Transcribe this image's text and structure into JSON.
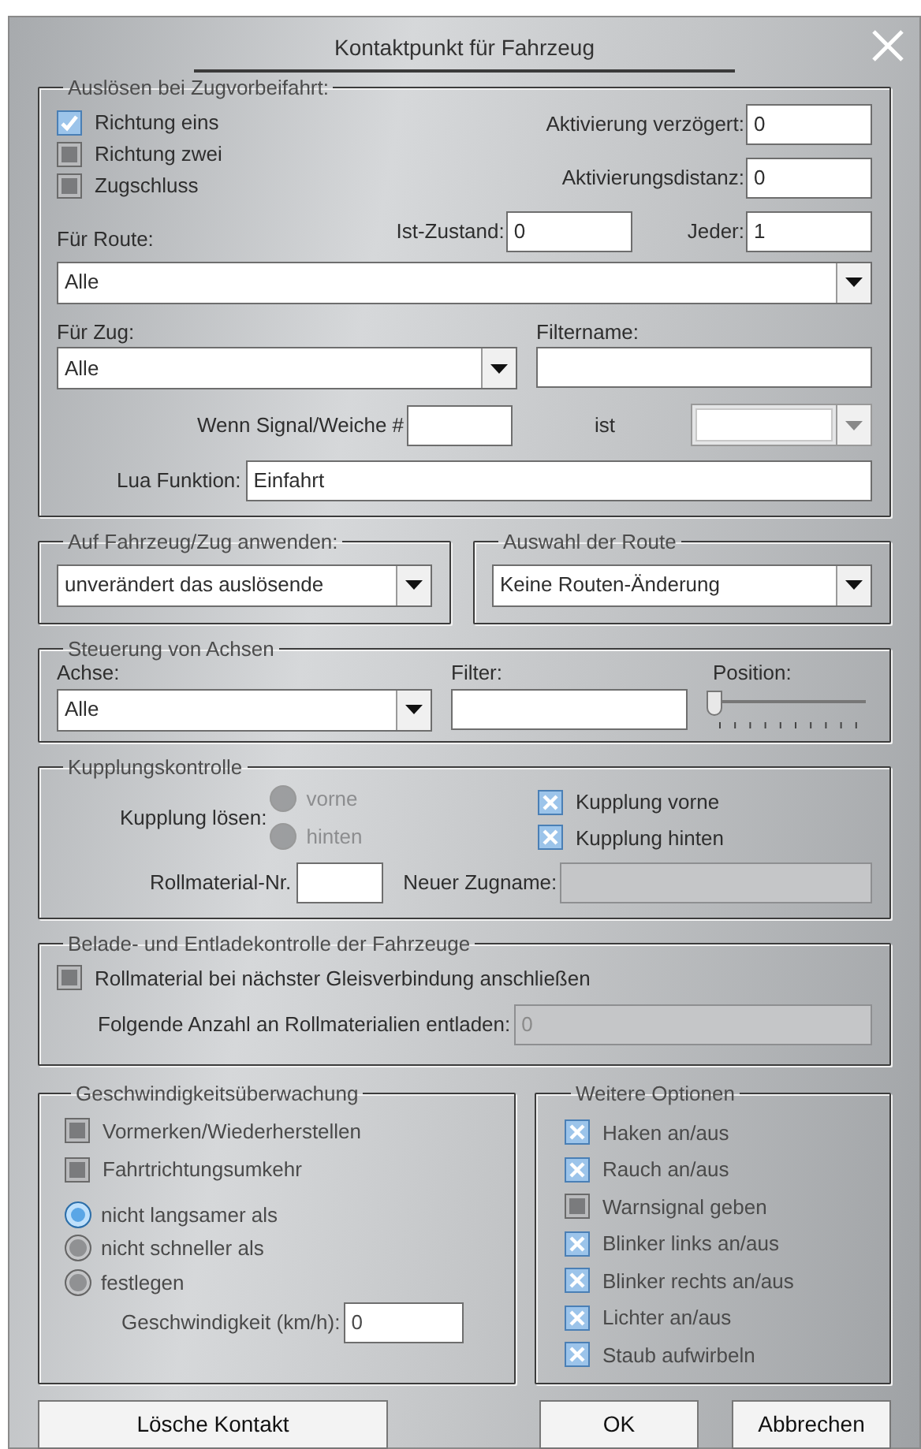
{
  "window": {
    "title": "Kontaktpunkt für Fahrzeug"
  },
  "trigger": {
    "title": "Auslösen bei Zugvorbeifahrt:",
    "checkboxes": [
      {
        "label": "Richtung eins",
        "checked": true
      },
      {
        "label": "Richtung zwei",
        "checked": false
      },
      {
        "label": "Zugschluss",
        "checked": false
      }
    ],
    "delay": {
      "label": "Aktivierung verzögert:",
      "value": "0"
    },
    "distance": {
      "label": "Aktivierungsdistanz:",
      "value": "0"
    },
    "state": {
      "label": "Ist-Zustand:",
      "value": "0"
    },
    "every": {
      "label": "Jeder:",
      "value": "1"
    },
    "route": {
      "label": "Für Route:",
      "value": "Alle"
    },
    "train": {
      "label": "Für Zug:",
      "value": "Alle"
    },
    "filter_name": {
      "label": "Filtername:"
    },
    "signal": {
      "label": "Wenn Signal/Weiche #",
      "is_label": "ist",
      "disabled": true
    },
    "lua": {
      "label": "Lua Funktion:",
      "value": "Einfahrt"
    }
  },
  "apply": {
    "title": "Auf Fahrzeug/Zug anwenden:",
    "value": "unverändert das auslösende"
  },
  "route_select": {
    "title": "Auswahl der Route",
    "value": "Keine Routen-Änderung"
  },
  "axes": {
    "title": "Steuerung von Achsen",
    "axis": {
      "label": "Achse:",
      "value": "Alle"
    },
    "filter": {
      "label": "Filter:"
    },
    "position": {
      "label": "Position:",
      "level": 0
    }
  },
  "coupling": {
    "title": "Kupplungskontrolle",
    "release_label": "Kupplung lösen:",
    "radios": [
      {
        "label": "vorne",
        "selected": false,
        "disabled": true
      },
      {
        "label": "hinten",
        "selected": false,
        "disabled": true
      }
    ],
    "checkboxes": [
      {
        "label": "Kupplung vorne",
        "checked": true
      },
      {
        "label": "Kupplung hinten",
        "checked": true
      }
    ],
    "rolling_label": "Rollmaterial-Nr.",
    "new_name": {
      "label": "Neuer Zugname:",
      "disabled": true
    }
  },
  "loading": {
    "title": "Belade- und Entladekontrolle der Fahrzeuge",
    "checkbox": {
      "label": "Rollmaterial bei nächster Gleisverbindung anschließen",
      "checked": false
    },
    "unload": {
      "label": "Folgende Anzahl an Rollmaterialien entladen:",
      "value": "0",
      "disabled": true
    }
  },
  "speed": {
    "title": "Geschwindigkeitsüberwachung",
    "checkboxes": [
      {
        "label": "Vormerken/Wiederherstellen",
        "checked": false
      },
      {
        "label": "Fahrtrichtungsumkehr",
        "checked": false
      }
    ],
    "radios": [
      {
        "label": "nicht langsamer als",
        "selected": true
      },
      {
        "label": "nicht schneller als",
        "selected": false
      },
      {
        "label": "festlegen",
        "selected": false
      }
    ],
    "speed": {
      "label": "Geschwindigkeit (km/h):",
      "value": "0"
    }
  },
  "options": {
    "title": "Weitere Optionen",
    "checkboxes": [
      {
        "label": "Haken an/aus",
        "checked": true
      },
      {
        "label": "Rauch an/aus",
        "checked": true
      },
      {
        "label": "Warnsignal geben",
        "checked": false
      },
      {
        "label": "Blinker links an/aus",
        "checked": true
      },
      {
        "label": "Blinker rechts an/aus",
        "checked": true
      },
      {
        "label": "Lichter an/aus",
        "checked": true
      },
      {
        "label": "Staub aufwirbeln",
        "checked": true
      }
    ]
  },
  "buttons": [
    {
      "label": "Lösche Kontakt"
    },
    {
      "label": "OK"
    },
    {
      "label": "Abbrechen"
    }
  ]
}
